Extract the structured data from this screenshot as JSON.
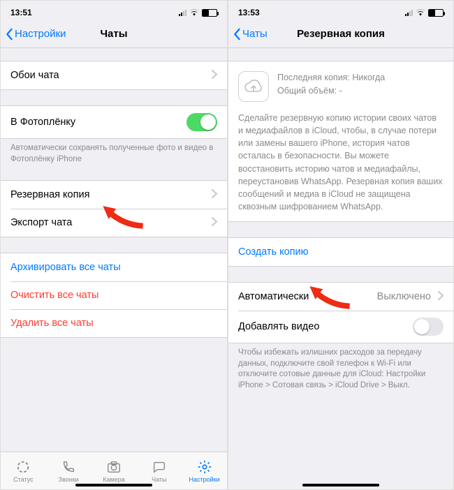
{
  "left": {
    "status": {
      "time": "13:51"
    },
    "nav": {
      "back": "Настройки",
      "title": "Чаты"
    },
    "cells": {
      "wallpaper": "Обои чата",
      "camera_roll": "В Фотоплёнку",
      "camera_roll_note": "Автоматически сохранять полученные фото и видео в Фотоплёнку iPhone",
      "backup": "Резервная копия",
      "export": "Экспорт чата",
      "archive_all": "Архивировать все чаты",
      "clear_all": "Очистить все чаты",
      "delete_all": "Удалить все чаты"
    },
    "tabs": {
      "status": "Статус",
      "calls": "Звонки",
      "camera": "Камера",
      "chats": "Чаты",
      "settings": "Настройки"
    }
  },
  "right": {
    "status": {
      "time": "13:53"
    },
    "nav": {
      "back": "Чаты",
      "title": "Резервная копия"
    },
    "info": {
      "last_line": "Последняя копия: Никогда",
      "size_line": "Общий объём: -",
      "desc": "Сделайте резервную копию истории своих чатов и медиафайлов в iCloud, чтобы, в случае потери или замены вашего iPhone, история чатов осталась в безопасности. Вы можете восстановить историю чатов и медиафайлы, переустановив WhatsApp. Резервная копия ваших сообщений и медиа в iCloud не защищена сквозным шифрованием WhatsApp."
    },
    "actions": {
      "create": "Создать копию",
      "auto_label": "Автоматически",
      "auto_value": "Выключено",
      "include_video": "Добавлять видео",
      "footer": "Чтобы избежать излишних расходов за передачу данных, подключите свой телефон к Wi-Fi или отключите сотовые данные для iCloud: Настройки iPhone > Сотовая связь > iCloud Drive > Выкл."
    }
  }
}
